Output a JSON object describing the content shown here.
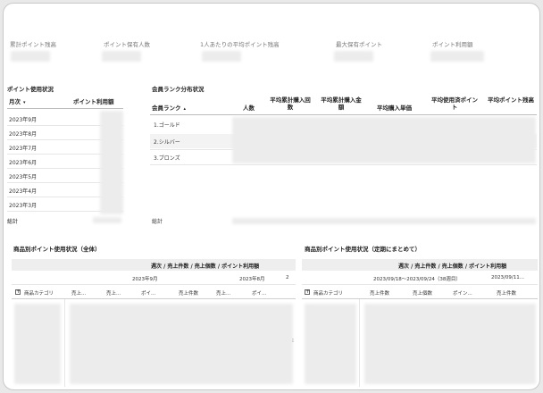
{
  "kpis": [
    {
      "label": "累計ポイント残高"
    },
    {
      "label": "ポイント保有人数"
    },
    {
      "label": "1人あたりの平均ポイント残高"
    },
    {
      "label": "最大保有ポイント"
    },
    {
      "label": "ポイント利用額"
    }
  ],
  "usage": {
    "title": "ポイント使用状況",
    "col_month": "月次",
    "col_amount": "ポイント利用額",
    "sort_icon": "sort-desc-icon",
    "months": [
      "2023年9月",
      "2023年8月",
      "2023年7月",
      "2023年6月",
      "2023年5月",
      "2023年4月",
      "2023年3月"
    ],
    "total_label": "総計"
  },
  "rank": {
    "title": "会員ランク分布状況",
    "headers": [
      "会員ランク",
      "人数",
      "平均累計購入回数",
      "平均累計購入金額",
      "平均購入単価",
      "平均使用済ポイント",
      "平均ポイント残高"
    ],
    "rows": [
      "1.ゴールド",
      "2.シルバー",
      "3.ブロンズ"
    ],
    "total_label": "総計"
  },
  "product_all": {
    "title": "商品別ポイント使用状況（全体）",
    "band": "週次 / 売上件数 / 売上個数 / ポイント利用額",
    "periods": [
      "2023年9月",
      "2023年8月",
      "2"
    ],
    "category_label": "商品カテゴリ",
    "subcols": [
      "売上...",
      "売上...",
      "ポイ...",
      "売上件数",
      "売上...",
      "ポイ..."
    ]
  },
  "product_weekly": {
    "title": "商品別ポイント使用状況（定期にまとめて）",
    "band": "週次 / 売上件数 / 売上個数 / ポイント利用額",
    "periods": [
      "2023/09/18～2023/09/24（38週目）",
      "2023/09/11..."
    ],
    "category_label": "商品カテゴリ",
    "subcols": [
      "売上件数",
      "売上個数",
      "ポイン...",
      "売上件数"
    ]
  },
  "colors": {
    "background": "#e9e9e9",
    "card": "#ffffff",
    "band": "#eeeeee",
    "redacted": "#ececec"
  }
}
